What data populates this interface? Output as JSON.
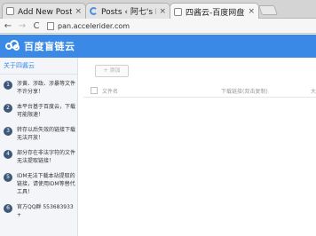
{
  "browser": {
    "tabs": [
      {
        "title": "Add New Post ‹ 阿",
        "icon": "document-icon"
      },
      {
        "title": "Posts ‹ 阿七's BLO",
        "icon": "loading-icon"
      },
      {
        "title": "四酱云-百度网盘高",
        "icon": "document-icon",
        "active": true
      }
    ],
    "close_glyph": "×",
    "back_glyph": "←",
    "forward_glyph": "→",
    "reload_glyph": "C",
    "url": "pan.accelerider.com"
  },
  "site": {
    "brand": "百度盲链云",
    "brand_color": "#3a89e7"
  },
  "sidebar": {
    "about": "关于四酱云",
    "notes": [
      {
        "num": "1",
        "text": "涉黄、涉政、涉暴等文件不许分享！"
      },
      {
        "num": "2",
        "text": "本平台基于百度云，下载可能限速！"
      },
      {
        "num": "3",
        "text": "转存以后失效的链接下载无法开放！"
      },
      {
        "num": "4",
        "text": "部分存在非法字符的文件无法提取链接！"
      },
      {
        "num": "5",
        "text": "IDM无法下载本站提取的链接，请使用IDM等替代工具！"
      },
      {
        "num": "6",
        "text": "官方QQ群 553683933+"
      }
    ]
  },
  "main": {
    "add_button": "+ 添加",
    "columns": {
      "name": "文件名",
      "link": "下载链接(双击复制)",
      "more": "大"
    }
  }
}
